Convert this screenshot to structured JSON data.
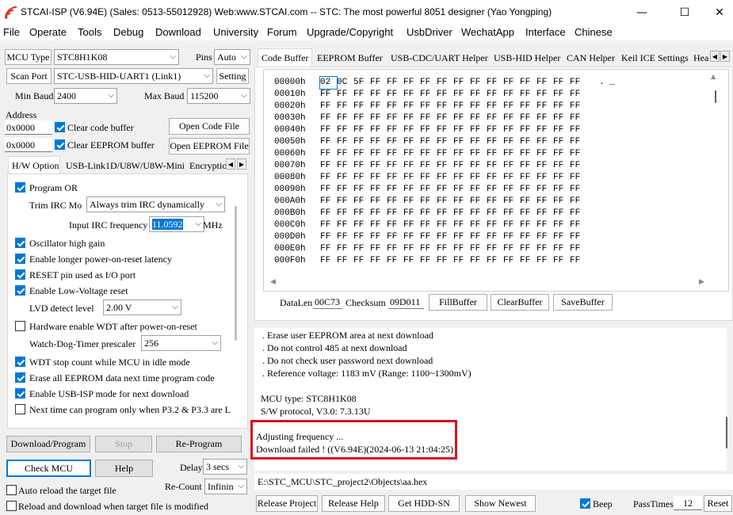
{
  "window": {
    "title": "STCAI-ISP (V6.94E) (Sales: 0513-55012928) Web:www.STCAI.com  -- STC: The most powerful 8051 designer (Yao Yongping)",
    "minimize": "—",
    "maximize": "☐",
    "close": "✕"
  },
  "menu": [
    "File",
    "Operate",
    "Tools",
    "Debug",
    "Download",
    "University",
    "Forum",
    "Upgrade/Copyright",
    "UsbDriver",
    "WechatApp",
    "Interface",
    "Chinese"
  ],
  "left": {
    "mcu_type_btn": "MCU Type",
    "mcu_type_value": "STC8H1K08",
    "pins_label": "Pins",
    "pins_value": "Auto",
    "scan_port_btn": "Scan Port",
    "port_value": "STC-USB-HID-UART1 (Link1)",
    "setting_btn": "Setting",
    "min_baud_label": "Min Baud",
    "min_baud_value": "2400",
    "max_baud_label": "Max Baud",
    "max_baud_value": "115200",
    "address_label": "Address",
    "address1": "0x0000",
    "address2": "0x0000",
    "clear_code": "Clear code buffer",
    "clear_eeprom": "Clear EEPROM buffer",
    "open_code": "Open Code File",
    "open_eeprom": "Open EEPROM File",
    "tabs": [
      "H/W Option",
      "USB-Link1D/U8W/U8W-Mini",
      "Encryptio"
    ],
    "hw": {
      "program_or": "Program OR",
      "trim_label": "Trim IRC Mo",
      "trim_value": "Always trim IRC dynamically",
      "irc_label": "Input IRC frequency",
      "irc_value": "11.0592",
      "irc_unit": "MHz",
      "osc_high": "Oscillator high gain",
      "longer_por": "Enable longer power-on-reset latency",
      "reset_pin": "RESET pin used as I/O port",
      "low_voltage": "Enable Low-Voltage reset",
      "lvd_label": "LVD detect level",
      "lvd_value": "2.00 V",
      "hw_wdt": "Hardware enable WDT after power-on-reset",
      "wdt_label": "Watch-Dog-Timer prescaler",
      "wdt_value": "256",
      "wdt_idle": "WDT stop count while MCU in idle mode",
      "erase_eeprom": "Erase all EEPROM data next time program code",
      "usb_isp": "Enable USB-ISP mode for next download",
      "next_time": "Next time can program only when P3.2 & P3.3 are L"
    },
    "download_btn": "Download/Program",
    "stop_btn": "Stop",
    "reprogram_btn": "Re-Program",
    "check_mcu_btn": "Check MCU",
    "help_btn": "Help",
    "delay_label": "Delay",
    "delay_value": "3 secs",
    "auto_reload": "Auto reload the target file",
    "recount_label": "Re-Count",
    "recount_value": "Infinin",
    "reload_download": "Reload and download when target file is modified"
  },
  "right": {
    "tabs": [
      "Code Buffer",
      "EEPROM Buffer",
      "USB-CDC/UART Helper",
      "USB-HID Helper",
      "CAN Helper",
      "Keil ICE Settings",
      "Hea"
    ],
    "hex": {
      "rows": [
        {
          "addr": "00000h",
          "bytes": [
            "02",
            "0C",
            "5F",
            "FF",
            "FF",
            "FF",
            "FF",
            "FF",
            "FF",
            "FF",
            "FF",
            "FF",
            "FF",
            "FF",
            "FF",
            "FF"
          ],
          "ascii": ". _"
        },
        {
          "addr": "00010h",
          "bytes": [
            "FF",
            "FF",
            "FF",
            "FF",
            "FF",
            "FF",
            "FF",
            "FF",
            "FF",
            "FF",
            "FF",
            "FF",
            "FF",
            "FF",
            "FF",
            "FF"
          ],
          "ascii": ""
        },
        {
          "addr": "00020h",
          "bytes": [
            "FF",
            "FF",
            "FF",
            "FF",
            "FF",
            "FF",
            "FF",
            "FF",
            "FF",
            "FF",
            "FF",
            "FF",
            "FF",
            "FF",
            "FF",
            "FF"
          ],
          "ascii": ""
        },
        {
          "addr": "00030h",
          "bytes": [
            "FF",
            "FF",
            "FF",
            "FF",
            "FF",
            "FF",
            "FF",
            "FF",
            "FF",
            "FF",
            "FF",
            "FF",
            "FF",
            "FF",
            "FF",
            "FF"
          ],
          "ascii": ""
        },
        {
          "addr": "00040h",
          "bytes": [
            "FF",
            "FF",
            "FF",
            "FF",
            "FF",
            "FF",
            "FF",
            "FF",
            "FF",
            "FF",
            "FF",
            "FF",
            "FF",
            "FF",
            "FF",
            "FF"
          ],
          "ascii": ""
        },
        {
          "addr": "00050h",
          "bytes": [
            "FF",
            "FF",
            "FF",
            "FF",
            "FF",
            "FF",
            "FF",
            "FF",
            "FF",
            "FF",
            "FF",
            "FF",
            "FF",
            "FF",
            "FF",
            "FF"
          ],
          "ascii": ""
        },
        {
          "addr": "00060h",
          "bytes": [
            "FF",
            "FF",
            "FF",
            "FF",
            "FF",
            "FF",
            "FF",
            "FF",
            "FF",
            "FF",
            "FF",
            "FF",
            "FF",
            "FF",
            "FF",
            "FF"
          ],
          "ascii": ""
        },
        {
          "addr": "00070h",
          "bytes": [
            "FF",
            "FF",
            "FF",
            "FF",
            "FF",
            "FF",
            "FF",
            "FF",
            "FF",
            "FF",
            "FF",
            "FF",
            "FF",
            "FF",
            "FF",
            "FF"
          ],
          "ascii": ""
        },
        {
          "addr": "00080h",
          "bytes": [
            "FF",
            "FF",
            "FF",
            "FF",
            "FF",
            "FF",
            "FF",
            "FF",
            "FF",
            "FF",
            "FF",
            "FF",
            "FF",
            "FF",
            "FF",
            "FF"
          ],
          "ascii": ""
        },
        {
          "addr": "00090h",
          "bytes": [
            "FF",
            "FF",
            "FF",
            "FF",
            "FF",
            "FF",
            "FF",
            "FF",
            "FF",
            "FF",
            "FF",
            "FF",
            "FF",
            "FF",
            "FF",
            "FF"
          ],
          "ascii": ""
        },
        {
          "addr": "000A0h",
          "bytes": [
            "FF",
            "FF",
            "FF",
            "FF",
            "FF",
            "FF",
            "FF",
            "FF",
            "FF",
            "FF",
            "FF",
            "FF",
            "FF",
            "FF",
            "FF",
            "FF"
          ],
          "ascii": ""
        },
        {
          "addr": "000B0h",
          "bytes": [
            "FF",
            "FF",
            "FF",
            "FF",
            "FF",
            "FF",
            "FF",
            "FF",
            "FF",
            "FF",
            "FF",
            "FF",
            "FF",
            "FF",
            "FF",
            "FF"
          ],
          "ascii": ""
        },
        {
          "addr": "000C0h",
          "bytes": [
            "FF",
            "FF",
            "FF",
            "FF",
            "FF",
            "FF",
            "FF",
            "FF",
            "FF",
            "FF",
            "FF",
            "FF",
            "FF",
            "FF",
            "FF",
            "FF"
          ],
          "ascii": ""
        },
        {
          "addr": "000D0h",
          "bytes": [
            "FF",
            "FF",
            "FF",
            "FF",
            "FF",
            "FF",
            "FF",
            "FF",
            "FF",
            "FF",
            "FF",
            "FF",
            "FF",
            "FF",
            "FF",
            "FF"
          ],
          "ascii": ""
        },
        {
          "addr": "000E0h",
          "bytes": [
            "FF",
            "FF",
            "FF",
            "FF",
            "FF",
            "FF",
            "FF",
            "FF",
            "FF",
            "FF",
            "FF",
            "FF",
            "FF",
            "FF",
            "FF",
            "FF"
          ],
          "ascii": ""
        },
        {
          "addr": "000F0h",
          "bytes": [
            "FF",
            "FF",
            "FF",
            "FF",
            "FF",
            "FF",
            "FF",
            "FF",
            "FF",
            "FF",
            "FF",
            "FF",
            "FF",
            "FF",
            "FF",
            "FF"
          ],
          "ascii": ""
        }
      ]
    },
    "datalen_label": "DataLen",
    "datalen_value": "00C73",
    "checksum_label": "Checksum",
    "checksum_value": "09D011",
    "fill_btn": "FillBuffer",
    "clear_btn": "ClearBuffer",
    "save_btn": "SaveBuffer",
    "log": [
      ". Erase user EEPROM area at next download",
      ". Do not control 485 at next download",
      ". Do not check user password next download",
      ". Reference voltage: 1183 mV (Range: 1100~1300mV)",
      "",
      "MCU type: STC8H1K08",
      "S/W protocol, V3.0: 7.3.13U",
      "",
      "Adjusting frequency ...",
      "Download failed ! ((V6.94E)(2024-06-13 21:04:25)"
    ],
    "file_path": "E:\\STC_MCU\\STC_project2\\Objects\\aa.hex",
    "release_project_btn": "Release Project",
    "release_help_btn": "Release Help",
    "get_hdd_btn": "Get HDD-SN",
    "show_newest_btn": "Show Newest",
    "beep_label": "Beep",
    "passtimes_label": "PassTimes",
    "passtimes_value": "12",
    "reset_btn": "Reset"
  },
  "colors": {
    "accent": "#0078d7",
    "highlight_box": "#d7141a",
    "window_bg": "#f0f0f0"
  }
}
